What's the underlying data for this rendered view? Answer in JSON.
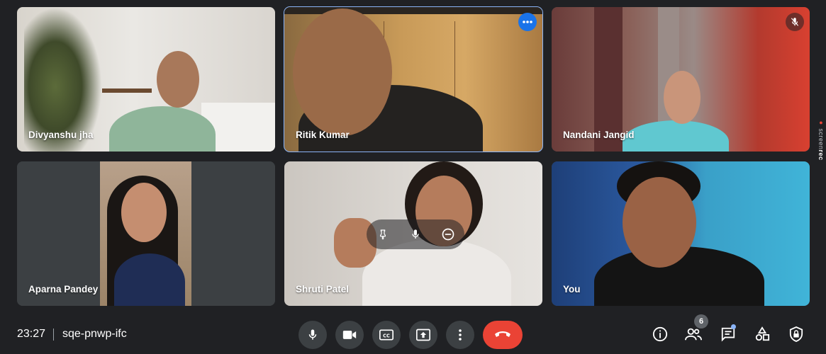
{
  "participants": [
    {
      "name": "Divyanshu jha"
    },
    {
      "name": "Ritik Kumar"
    },
    {
      "name": "Nandani Jangid"
    },
    {
      "name": "Aparna Pandey"
    },
    {
      "name": "Shruti Patel"
    },
    {
      "name": "You"
    }
  ],
  "recorder": {
    "label_prefix": "screen",
    "label_suffix": "rec"
  },
  "meeting": {
    "time": "23:27",
    "code": "sqe-pnwp-ifc"
  },
  "people_count": "6",
  "colors": {
    "hangup": "#ea4335",
    "active_border": "#8ab4f8",
    "control_bg": "#3c4043",
    "background": "#202124"
  },
  "icons": [
    "more-options-icon",
    "mic-off-icon",
    "pin-icon",
    "mic-icon",
    "remove-icon",
    "camera-icon",
    "captions-icon",
    "present-icon",
    "more-vert-icon",
    "hangup-icon",
    "info-icon",
    "people-icon",
    "chat-icon",
    "activities-icon",
    "host-controls-icon"
  ]
}
